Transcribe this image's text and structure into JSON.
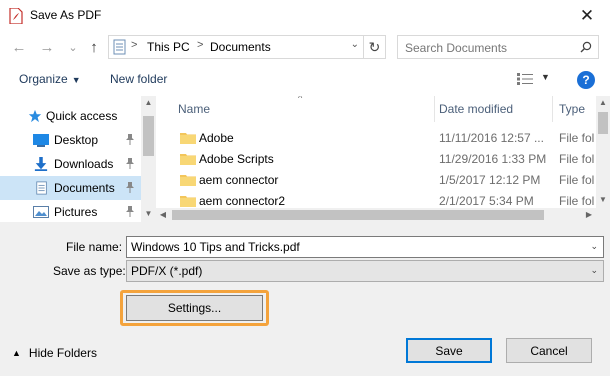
{
  "window": {
    "title": "Save As PDF",
    "close_glyph": "✕",
    "title_icon": "pdf-icon"
  },
  "nav": {
    "back_glyph": "←",
    "forward_glyph": "→",
    "recent_glyph": "⌄",
    "up_glyph": "↑",
    "address": {
      "icon": "documents-folder-icon",
      "separator": ">",
      "segments": [
        "This PC",
        "Documents"
      ],
      "dropdown_glyph": "⌄"
    },
    "refresh_glyph": "↻",
    "search": {
      "placeholder": "Search Documents",
      "icon": "search-icon"
    }
  },
  "toolbar": {
    "organize_label": "Organize",
    "new_folder_label": "New folder",
    "view_icon": "view-details-icon",
    "help_glyph": "?"
  },
  "sidebar": {
    "items": [
      {
        "label": "Quick access",
        "icon": "star-icon",
        "pinned": false,
        "selected": false
      },
      {
        "label": "Desktop",
        "icon": "desktop-icon",
        "pinned": true,
        "selected": false
      },
      {
        "label": "Downloads",
        "icon": "download-icon",
        "pinned": true,
        "selected": false
      },
      {
        "label": "Documents",
        "icon": "documents-icon",
        "pinned": true,
        "selected": true
      },
      {
        "label": "Pictures",
        "icon": "pictures-icon",
        "pinned": true,
        "selected": false
      }
    ]
  },
  "files": {
    "columns": [
      "Name",
      "Date modified",
      "Type"
    ],
    "sort_glyph": "^",
    "rows": [
      {
        "name": "Adobe",
        "date": "11/11/2016 12:57 ...",
        "type": "File fol"
      },
      {
        "name": "Adobe Scripts",
        "date": "11/29/2016 1:33 PM",
        "type": "File fol"
      },
      {
        "name": "aem connector",
        "date": "1/5/2017 12:12 PM",
        "type": "File fol"
      },
      {
        "name": "aem connector2",
        "date": "2/1/2017 5:34 PM",
        "type": "File fol"
      }
    ]
  },
  "form": {
    "file_name_label": "File name:",
    "file_name_value": "Windows 10 Tips and Tricks.pdf",
    "save_type_label": "Save as type:",
    "save_type_value": "PDF/X (*.pdf)",
    "settings_label": "Settings...",
    "highlight_color": "#f4a33c"
  },
  "footer": {
    "hide_folders_label": "Hide Folders",
    "save_label": "Save",
    "cancel_label": "Cancel"
  }
}
